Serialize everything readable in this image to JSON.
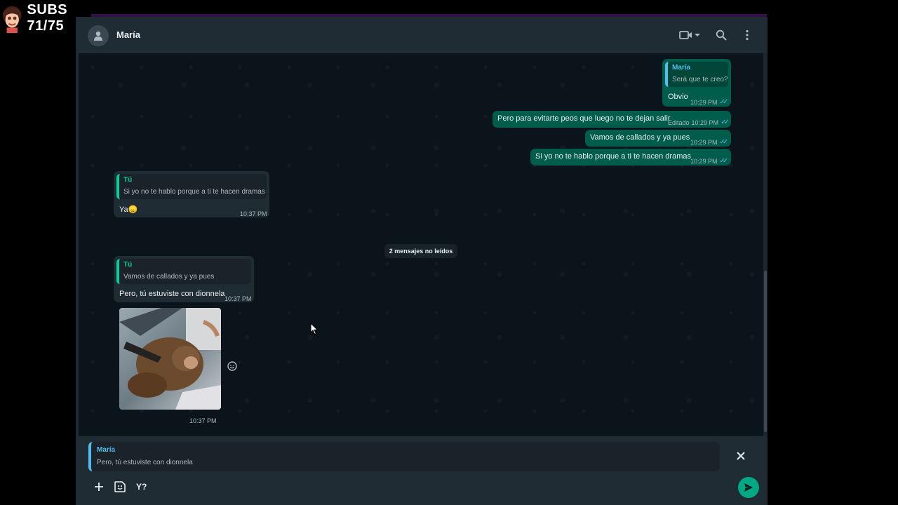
{
  "overlay": {
    "subs_text": "SUBS 71/75"
  },
  "header": {
    "contact_name": "María",
    "icons": [
      "avatar-icon",
      "video-call-icon",
      "chevron-down-icon",
      "search-icon",
      "menu-icon"
    ]
  },
  "messages": [
    {
      "direction": "outgoing",
      "quote_author": "María",
      "quote_text": "Será que te creo?",
      "text": "Obvio",
      "time": "10:29 PM",
      "status": "read"
    },
    {
      "direction": "outgoing",
      "text": "Pero para evitarte peos que luego no te dejan salir",
      "edited_label": "Editado",
      "time": "10:29 PM",
      "status": "read"
    },
    {
      "direction": "outgoing",
      "text": "Vamos de callados y ya pues",
      "time": "10:29 PM",
      "status": "read"
    },
    {
      "direction": "outgoing",
      "text": "Si yo no te hablo porque a ti te hacen dramas",
      "time": "10:29 PM",
      "status": "read"
    },
    {
      "direction": "incoming",
      "quote_author": "Tú",
      "quote_text": "Si yo no te hablo porque a ti te hacen dramas",
      "text": "Ya",
      "emoji": "😞",
      "time": "10:37 PM"
    },
    {
      "direction": "incoming",
      "quote_author": "Tú",
      "quote_text": "Vamos de callados y ya pues",
      "text": "Pero, tú estuviste con dionnela",
      "time": "10:37 PM"
    },
    {
      "direction": "incoming",
      "type": "image",
      "time": "10:37 PM"
    }
  ],
  "unread_label": "2 mensajes no leídos",
  "composer": {
    "reply_author": "María",
    "reply_text": "Pero, tú estuviste con dionnela",
    "input_value": "Y?",
    "icons": [
      "plus-icon",
      "sticker-icon",
      "close-icon",
      "send-icon"
    ]
  },
  "colors": {
    "outgoing_bubble": "#005c4b",
    "incoming_bubble": "#202c33",
    "accent_green": "#00a884",
    "quote_blue": "#53bdeb",
    "quote_green": "#06cf9c",
    "chat_bg": "#0b141a"
  }
}
